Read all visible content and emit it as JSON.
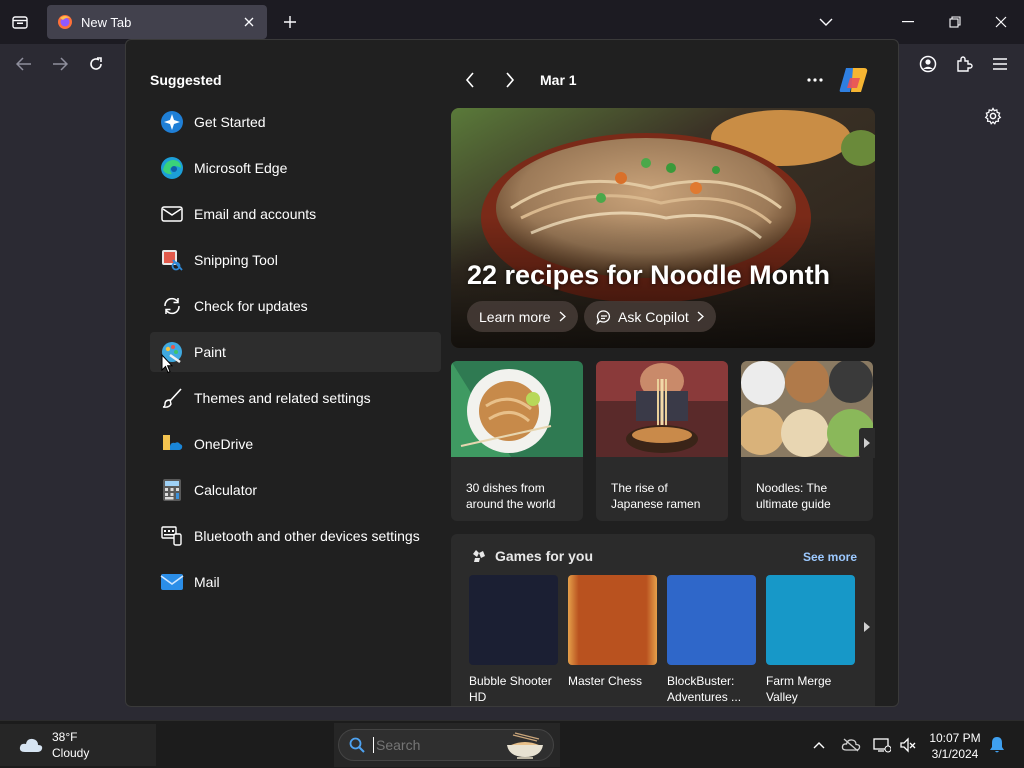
{
  "browser": {
    "tab_title": "New Tab"
  },
  "start": {
    "suggested_title": "Suggested",
    "items": [
      {
        "label": "Get Started"
      },
      {
        "label": "Microsoft Edge"
      },
      {
        "label": "Email and accounts"
      },
      {
        "label": "Snipping Tool"
      },
      {
        "label": "Check for updates"
      },
      {
        "label": "Paint"
      },
      {
        "label": "Themes and related settings"
      },
      {
        "label": "OneDrive"
      },
      {
        "label": "Calculator"
      },
      {
        "label": "Bluetooth and other devices settings"
      },
      {
        "label": "Mail"
      }
    ],
    "date": "Mar 1",
    "hero": {
      "title": "22 recipes for Noodle Month",
      "learn_more": "Learn more",
      "ask_copilot": "Ask Copilot"
    },
    "cards": [
      {
        "text": "30 dishes from around the world"
      },
      {
        "text": "The rise of Japanese ramen"
      },
      {
        "text": "Noodles: The ultimate guide"
      }
    ],
    "games": {
      "title": "Games for you",
      "see_more": "See more",
      "items": [
        {
          "name": "Bubble Shooter HD",
          "color": "#1b1f33"
        },
        {
          "name": "Master Chess",
          "color": "#b9521f"
        },
        {
          "name": "BlockBuster: Adventures ...",
          "color": "#2f67c9"
        },
        {
          "name": "Farm Merge Valley",
          "color": "#1798c8"
        }
      ]
    }
  },
  "taskbar": {
    "weather_temp": "38°F",
    "weather_cond": "Cloudy",
    "search_placeholder": "Search",
    "time": "10:07 PM",
    "date": "3/1/2024"
  },
  "colors": {
    "accent_link": "#9cc9ff",
    "popup_bg": "#202020"
  }
}
